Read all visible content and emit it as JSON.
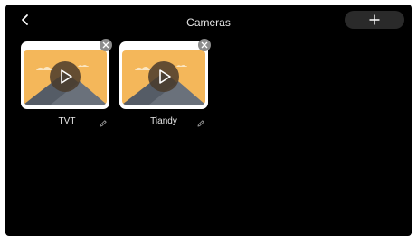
{
  "header": {
    "title": "Cameras",
    "back_icon": "chevron-left-icon",
    "add_icon": "plus-icon"
  },
  "cameras": [
    {
      "label": "TVT",
      "thumbnail_icon": "image-placeholder-icon",
      "play_icon": "play-icon",
      "remove_icon": "close-icon",
      "edit_icon": "pencil-icon"
    },
    {
      "label": "Tiandy",
      "thumbnail_icon": "image-placeholder-icon",
      "play_icon": "play-icon",
      "remove_icon": "close-icon",
      "edit_icon": "pencil-icon"
    }
  ],
  "colors": {
    "background": "#000000",
    "thumbnail_sky": "#f4b75a",
    "thumbnail_mountain": "#555c66",
    "play_overlay": "#4a3b2c",
    "add_button": "#2a2a2a"
  }
}
